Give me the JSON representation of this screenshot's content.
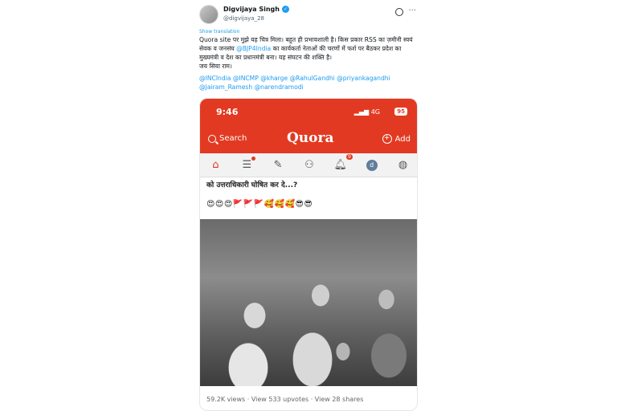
{
  "tweet": {
    "author_name": "Digvijaya Singh",
    "author_handle": "@digvijaya_28",
    "show_translation": "Show translation",
    "text_before": "Quora site पर मुझे यह चित्र मिला। बहुत ही प्रभावशाली है। किस प्रकार RSS का ज़मीनी स्वयं सेवक व जनसंघ ",
    "mention_bjp": "@BJP4India",
    "text_after": " का कार्यकर्ता नेताओं की चरणों में फर्श पर बैठकर प्रदेश का मुख्यमंत्री व देश का प्रधानमंत्री बना। यह संघटन की शक्ति है।",
    "closing": "जय सिया राम।",
    "mentions_line1": "@INCIndia @INCMP @kharge @RahulGandhi @priyankagandhi",
    "mentions_line2": "@Jairam_Ramesh @narendramodi"
  },
  "quora": {
    "status_time": "9:46",
    "status_signal": "4G",
    "status_battery": "95",
    "search_label": "Search",
    "logo": "Quora",
    "add_label": "Add",
    "notification_count": "9",
    "profile_initial": "d",
    "question_fragment": "को उत्तराधिकारी घोषित कर दे...?",
    "emojis": "😍😍😍🚩🚩🚩🥰🥰🥰😎😎",
    "stats": "59.2K views · View 533 upvotes · View 28 shares"
  },
  "colors": {
    "quora_red": "#e23a22",
    "link_blue": "#1d9bf0"
  },
  "icons": [
    "verified-badge-icon",
    "grok-icon",
    "more-options-icon",
    "search-icon",
    "plus-icon",
    "home-icon",
    "following-icon",
    "answer-icon",
    "spaces-icon",
    "notifications-icon",
    "profile-avatar",
    "globe-icon"
  ]
}
